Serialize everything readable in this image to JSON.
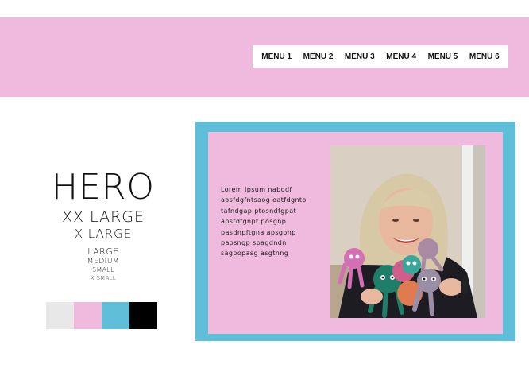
{
  "header": {
    "bg_color": "#efbade",
    "menu": [
      "MENU 1",
      "MENU 2",
      "MENU 3",
      "MENU 4",
      "MENU 5",
      "MENU 6"
    ]
  },
  "type_scale": {
    "hero": "HERO",
    "xx_large": "XX LARGE",
    "x_large": "X LARGE",
    "large": "LARGE",
    "medium": "MEDIUM",
    "small": "SMALL",
    "x_small": "X SMALL"
  },
  "swatches": [
    "#e8e8e8",
    "#efbade",
    "#5fbfd9",
    "#000000"
  ],
  "card": {
    "border_color": "#5fbfd9",
    "body_text": "Lorem Ipsum nabodf aosfdgfntsaog oatfdgnto tafndgap ptosndfgpat apstdfgnpt posgnp pasdnpftgna apsgonp paosngp spagdndn sagpopasg asgtnng",
    "photo_icon": "portrait-photo"
  }
}
